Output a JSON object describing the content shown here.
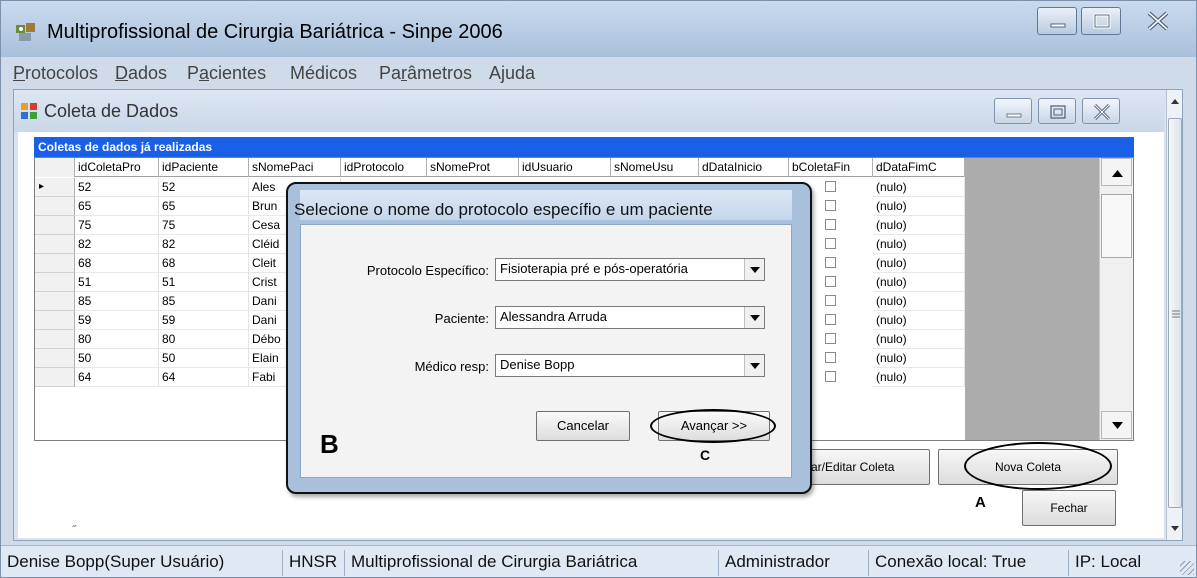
{
  "window": {
    "title": "Multiprofissional de Cirurgia Bariátrica - Sinpe 2006"
  },
  "menu": [
    {
      "label": "Protocolos",
      "accel": "P",
      "rest": "rotocolos"
    },
    {
      "label": "Dados",
      "accel": "D",
      "rest": "ados"
    },
    {
      "label": "Pacientes",
      "pre": "P",
      "accel": "a",
      "rest": "cientes"
    },
    {
      "label": "Médicos"
    },
    {
      "label": "Parâmetros",
      "pre": "Pa",
      "accel": "r",
      "rest": "âmetros"
    },
    {
      "label": "Ajuda",
      "pre": "A",
      "accel": "j",
      "rest": "uda"
    }
  ],
  "child_window": {
    "title": "Coleta de Dados"
  },
  "grid": {
    "caption": "Coletas de dados já realizadas",
    "columns": [
      "idColetaPro",
      "idPaciente",
      "sNomePaci",
      "idProtocolo",
      "sNomeProt",
      "idUsuario",
      "sNomeUsu",
      "dDataInicio",
      "bColetaFin",
      "dDataFimC"
    ],
    "rows": [
      {
        "indicator": "▸",
        "idColeta": "52",
        "idPaciente": "52",
        "nome": "Ales",
        "fim": "(nulo)"
      },
      {
        "indicator": "",
        "idColeta": "65",
        "idPaciente": "65",
        "nome": "Brun",
        "fim": "(nulo)"
      },
      {
        "indicator": "",
        "idColeta": "75",
        "idPaciente": "75",
        "nome": "Cesa",
        "fim": "(nulo)"
      },
      {
        "indicator": "",
        "idColeta": "82",
        "idPaciente": "82",
        "nome": "Cléid",
        "fim": "(nulo)"
      },
      {
        "indicator": "",
        "idColeta": "68",
        "idPaciente": "68",
        "nome": "Cleit",
        "fim": "(nulo)"
      },
      {
        "indicator": "",
        "idColeta": "51",
        "idPaciente": "51",
        "nome": "Crist",
        "fim": "(nulo)"
      },
      {
        "indicator": "",
        "idColeta": "85",
        "idPaciente": "85",
        "nome": "Dani",
        "fim": "(nulo)"
      },
      {
        "indicator": "",
        "idColeta": "59",
        "idPaciente": "59",
        "nome": "Dani",
        "fim": "(nulo)"
      },
      {
        "indicator": "",
        "idColeta": "80",
        "idPaciente": "80",
        "nome": "Débo",
        "fim": "(nulo)"
      },
      {
        "indicator": "",
        "idColeta": "50",
        "idPaciente": "50",
        "nome": "Elain",
        "fim": "(nulo)"
      },
      {
        "indicator": "",
        "idColeta": "64",
        "idPaciente": "64",
        "nome": "Fabi",
        "fim": "(nulo)"
      }
    ]
  },
  "buttons": {
    "editar": "ar/Editar Coleta",
    "nova_coleta": "Nova Coleta",
    "fechar": "Fechar"
  },
  "annotations": {
    "a": "A",
    "b": "B",
    "c": "C"
  },
  "dialog": {
    "title": "Selecione o nome do protocolo específio e um paciente",
    "protocolo_label": "Protocolo Específico:",
    "protocolo_value": "Fisioterapia pré e pós-operatória",
    "paciente_label": "Paciente:",
    "paciente_value": "Alessandra Arruda",
    "medico_label": "Médico resp:",
    "medico_value": "Denise Bopp",
    "cancel": "Cancelar",
    "next": "Avançar >>"
  },
  "statusbar": [
    "Denise Bopp(Super Usuário)",
    "HNSR",
    "Multiprofissional de Cirurgia Bariátrica",
    "Administrador",
    "Conexão local: True",
    "IP: Local"
  ],
  "colors": {
    "grid_caption": "#1a5fe8",
    "title_bar": "#b6cbe3",
    "dialog_frame": "#a8c0dc"
  }
}
